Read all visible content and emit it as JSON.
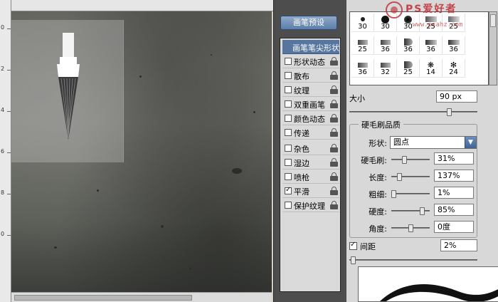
{
  "canvas": {
    "ruler_numbers": [
      "0",
      "2",
      "4",
      "6",
      "8",
      "0"
    ]
  },
  "brush_panel": {
    "preset_button": "画笔预设",
    "options": [
      {
        "label": "画笔笔尖形状",
        "checkbox": false,
        "active": true,
        "lock": false
      },
      {
        "label": "形状动态",
        "checkbox": false,
        "checked": false,
        "lock": true
      },
      {
        "label": "散布",
        "checkbox": true,
        "checked": false,
        "lock": true
      },
      {
        "label": "纹理",
        "checkbox": true,
        "checked": false,
        "lock": true
      },
      {
        "label": "双重画笔",
        "checkbox": true,
        "checked": false,
        "lock": true
      },
      {
        "label": "颜色动态",
        "checkbox": true,
        "checked": false,
        "lock": true
      },
      {
        "label": "传递",
        "checkbox": true,
        "checked": false,
        "lock": true
      },
      {
        "label": "杂色",
        "checkbox": true,
        "checked": false,
        "lock": true
      },
      {
        "label": "湿边",
        "checkbox": true,
        "checked": false,
        "lock": true
      },
      {
        "label": "喷枪",
        "checkbox": true,
        "checked": false,
        "lock": true
      },
      {
        "label": "平滑",
        "checkbox": true,
        "checked": true,
        "lock": true
      },
      {
        "label": "保护纹理",
        "checkbox": true,
        "checked": false,
        "lock": true
      }
    ],
    "brush_tips": {
      "row1": [
        "30",
        "30",
        "30",
        "25",
        "25"
      ],
      "row2": [
        "25",
        "36",
        "36",
        "36",
        "36"
      ],
      "row3": [
        "36",
        "32",
        "25",
        "14",
        "24"
      ]
    },
    "size": {
      "label": "大小",
      "value": "90 px",
      "slider_pct": 0.79
    },
    "bristle_quality": {
      "title": "硬毛刷品质",
      "shape_label": "形状:",
      "shape_value": "圆点",
      "rows": [
        {
          "label": "硬毛刷:",
          "value": "31%",
          "pct": 0.31
        },
        {
          "label": "长度:",
          "value": "137%",
          "pct": 0.18
        },
        {
          "label": "粗细:",
          "value": "1%",
          "pct": 0.01
        },
        {
          "label": "硬度:",
          "value": "85%",
          "pct": 0.85
        },
        {
          "label": "角度:",
          "value": "0度",
          "pct": 0.5
        }
      ]
    },
    "spacing": {
      "label": "间距",
      "value": "2%",
      "checked": true,
      "slider_pct": 0.01
    }
  },
  "watermark": {
    "text": "PS爱好者",
    "url": "www.psahz.com"
  }
}
